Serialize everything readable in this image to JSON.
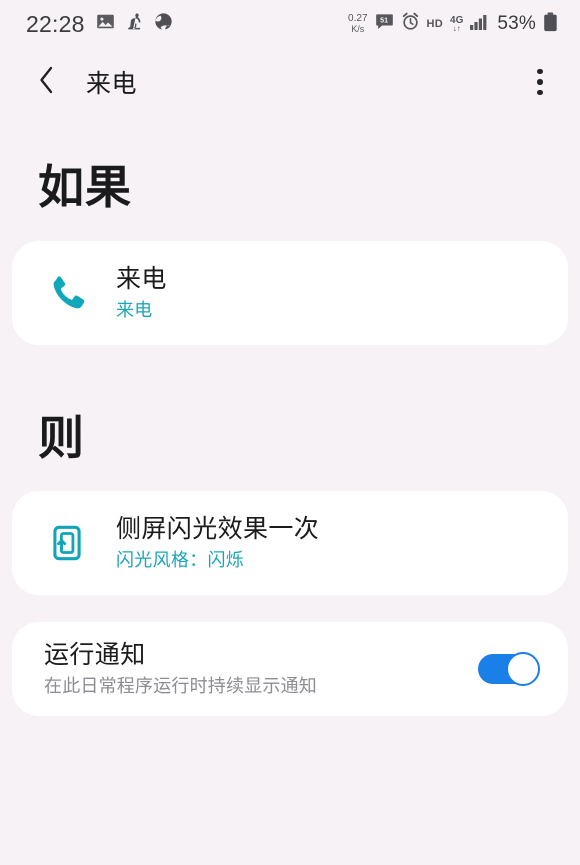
{
  "status_bar": {
    "time": "22:28",
    "left_icons": [
      "image-icon",
      "app-icon",
      "browser-icon"
    ],
    "network_speed_value": "0.27",
    "network_speed_unit": "K/s",
    "right_icons": [
      "message-badge-icon",
      "alarm-icon",
      "signal-bars-icon",
      "battery-icon"
    ],
    "hd_label": "HD",
    "network_type": "4G",
    "network_arrows": "↓↑",
    "battery_percent": "53%"
  },
  "app_bar": {
    "back_icon": "chevron-left-icon",
    "title": "来电",
    "overflow_icon": "more-vertical-icon"
  },
  "sections": {
    "if_label": "如果",
    "then_label": "则"
  },
  "trigger_card": {
    "icon": "phone-call-icon",
    "icon_color": "#0fa7ba",
    "title": "来电",
    "subtitle": "来电"
  },
  "action_card": {
    "icon": "edge-lighting-icon",
    "icon_color": "#12a5b7",
    "title": "侧屏闪光效果一次",
    "subtitle": "闪光风格：闪烁"
  },
  "notification_card": {
    "title": "运行通知",
    "subtitle": "在此日常程序运行时持续显示通知",
    "toggle_state": "on",
    "toggle_color": "#1b7fe8"
  },
  "theme": {
    "background": "#f6f2f6",
    "card_background": "#ffffff",
    "accent_teal": "#1ba6b8",
    "accent_blue": "#1b7fe8",
    "text_primary": "#1c1c1e",
    "text_secondary": "#8c8c92"
  }
}
